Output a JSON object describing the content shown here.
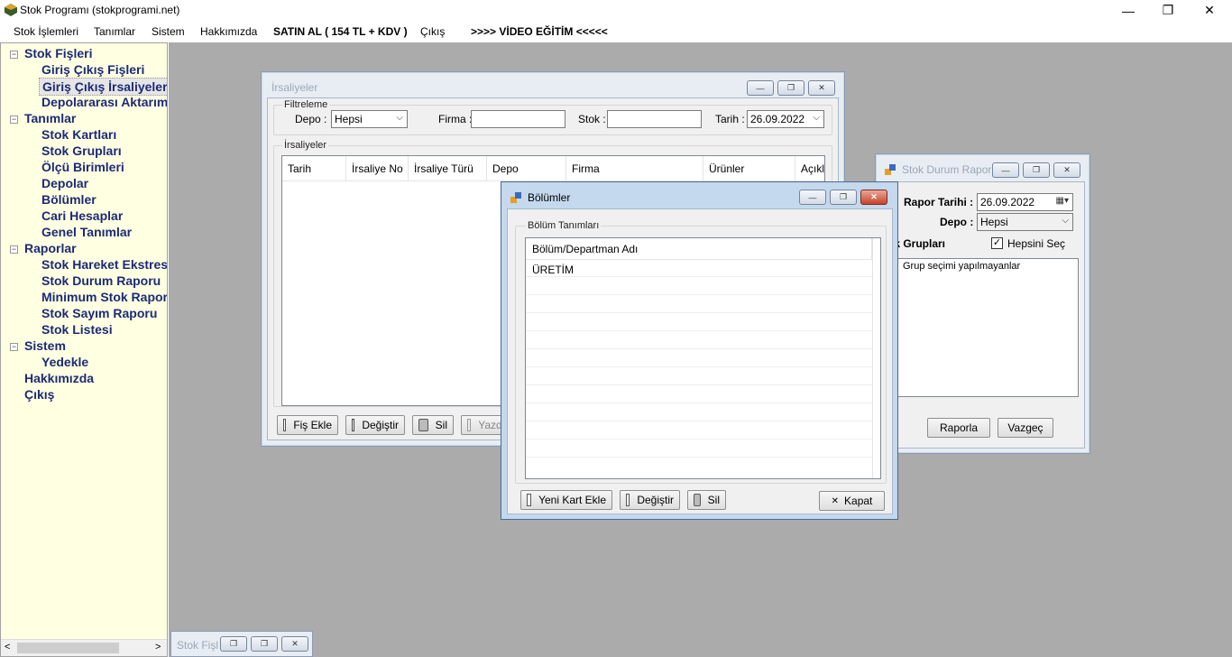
{
  "app": {
    "title": "Stok Programı (stokprogrami.net)"
  },
  "window_controls": {
    "minimize": "—",
    "restore": "❐",
    "close": "✕"
  },
  "menu": [
    {
      "label": "Stok İşlemleri"
    },
    {
      "label": "Tanımlar"
    },
    {
      "label": "Sistem"
    },
    {
      "label": "Hakkımızda"
    },
    {
      "label": "SATIN AL ( 154 TL + KDV )"
    },
    {
      "label": "Çıkış"
    },
    {
      "label": ">>>> VİDEO EĞİTİM <<<<<"
    }
  ],
  "tree": {
    "stok_fisleri": "Stok Fişleri",
    "giris_cikis_fisleri": "Giriş Çıkış Fişleri",
    "giris_cikis_irsaliyeleri": "Giriş Çıkış İrsaliyeleri",
    "depolararasi": "Depolararası Aktarım",
    "tanimlar": "Tanımlar",
    "stok_kartlari": "Stok Kartları",
    "stok_gruplari": "Stok Grupları",
    "olcu_birimleri": "Ölçü Birimleri",
    "depolar": "Depolar",
    "bolumler": "Bölümler",
    "cari_hesaplar": "Cari Hesaplar",
    "genel_tanimlar": "Genel Tanımlar",
    "raporlar": "Raporlar",
    "stok_hareket": "Stok Hareket Ekstresi",
    "stok_durum": "Stok Durum Raporu",
    "minimum_stok": "Minimum Stok Raporu",
    "stok_sayim": "Stok Sayım Raporu",
    "stok_listesi": "Stok Listesi",
    "sistem": "Sistem",
    "yedekle": "Yedekle",
    "hakkimizda": "Hakkımızda",
    "cikis": "Çıkış",
    "collapse_symbol": "−",
    "scroll_left": "<",
    "scroll_right": ">"
  },
  "irsaliyeler": {
    "title": "İrsaliyeler",
    "filter_group": "Filtreleme",
    "depo_label": "Depo :",
    "depo_value": "Hepsi",
    "firma_label": "Firma :",
    "firma_value": "",
    "stok_label": "Stok :",
    "stok_value": "",
    "tarih_label": "Tarih :",
    "tarih_value": "26.09.2022",
    "list_group": "İrsaliyeler",
    "columns": [
      "Tarih",
      "İrsaliye No",
      "İrsaliye Türü",
      "Depo",
      "Firma",
      "Ürünler",
      "Açıklama"
    ],
    "btn_fis_ekle": "Fiş Ekle",
    "btn_degistir": "Değiştir",
    "btn_sil": "Sil",
    "btn_yazdir": "Yazdır"
  },
  "bolumler": {
    "title": "Bölümler",
    "group": "Bölüm Tanımları",
    "column": "Bölüm/Departman Adı",
    "rows": [
      "ÜRETİM"
    ],
    "btn_yeni": "Yeni Kart Ekle",
    "btn_degistir": "Değiştir",
    "btn_sil": "Sil",
    "btn_kapat": "Kapat",
    "kapat_symbol": "✕"
  },
  "stok_durum": {
    "title": "Stok Durum Raporu",
    "rapor_tarihi_label": "Rapor Tarihi :",
    "rapor_tarihi_value": "26.09.2022",
    "depo_label": "Depo :",
    "depo_value": "Hepsi",
    "stok_gruplari_label": "Stok Grupları",
    "hepsini_sec": "Hepsini Seç",
    "hepsini_sec_checked": "✓",
    "groups": [
      "Grup seçimi yapılmayanlar"
    ],
    "btn_raporla": "Raporla",
    "btn_vazgec": "Vazgeç"
  },
  "minimized": {
    "title": "Stok Fişleri"
  }
}
